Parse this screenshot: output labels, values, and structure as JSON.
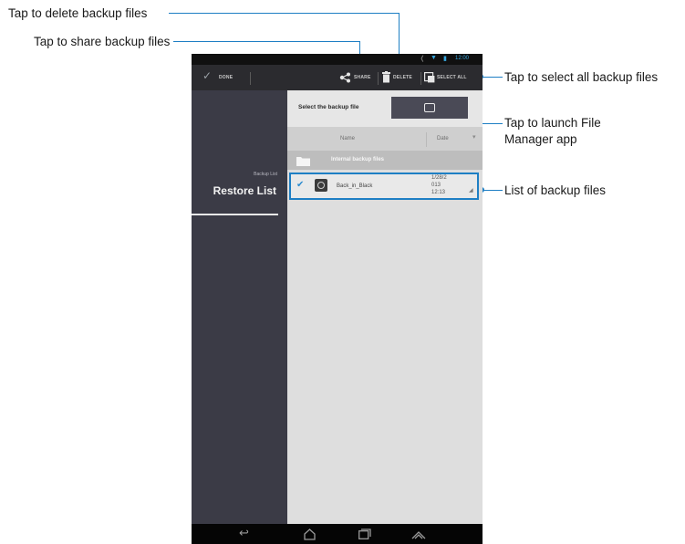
{
  "callouts": {
    "delete": "Tap to delete backup files",
    "share": "Tap to share backup files",
    "select_all": "Tap to select all backup files",
    "launch_line1": "Tap to launch File",
    "launch_line2": "Manager app",
    "list": "List of backup files"
  },
  "status_bar": {
    "time": "12:00"
  },
  "action_bar": {
    "done_label": "DONE",
    "share_label": "SHARE",
    "delete_label": "DELETE",
    "select_all_label": "SELECT ALL"
  },
  "sidebar": {
    "backup_list_label": "Backup List",
    "restore_list_label": "Restore List"
  },
  "main": {
    "select_file_label": "Select the backup file",
    "columns": {
      "name": "Name",
      "date": "Date"
    },
    "folder_label": "Internal backup files",
    "files": [
      {
        "name": "Back_in_Black",
        "date_line1": "1/28/2",
        "date_line2": "013",
        "date_line3": "12:13"
      }
    ]
  },
  "colors": {
    "accent": "#1e7fc4",
    "sidebar": "#3b3b46",
    "actionbar": "#2b2b2f"
  }
}
